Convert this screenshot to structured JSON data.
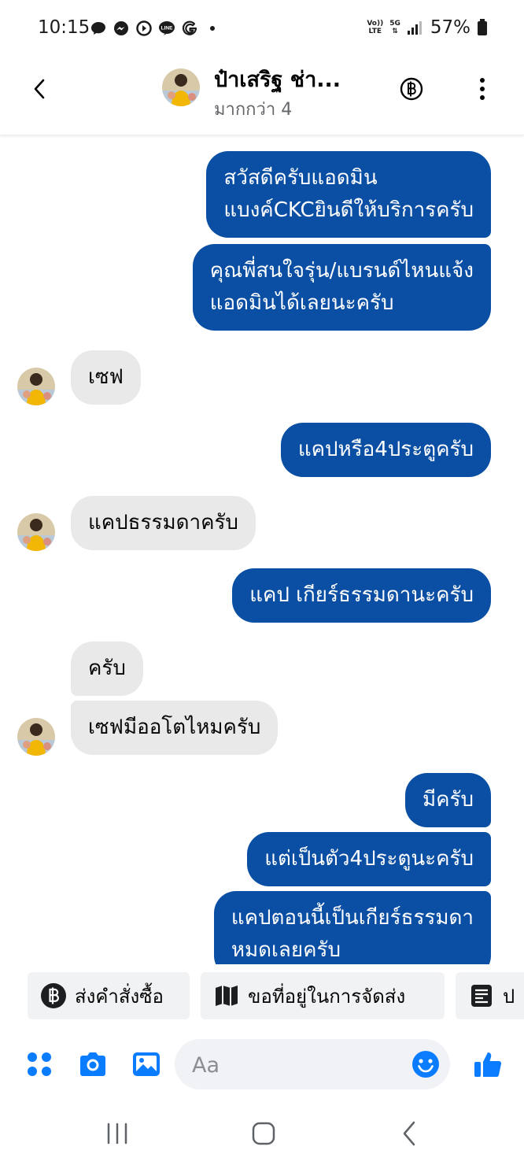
{
  "status_bar": {
    "time": "10:15",
    "network_top": "Vo))",
    "network_bottom": "LTE",
    "signal_type": "5G",
    "battery": "57%",
    "left_icons": [
      "chat-icon",
      "messenger-icon",
      "play-icon",
      "line-icon",
      "google-icon",
      "dot-icon"
    ]
  },
  "header": {
    "contact_name": "ป๋าเสริฐ ช่า...",
    "subtitle": "มากกว่า 4"
  },
  "messages": [
    {
      "dir": "out",
      "lines": [
        "สวัสดีครับแอดมิน",
        "แบงค์CKCยินดีให้บริการครับ"
      ]
    },
    {
      "dir": "out",
      "lines": [
        "คุณพี่สนใจรุ่น/แบรนด์ไหนแจ้ง",
        "แอดมินได้เลยนะครับ"
      ]
    },
    {
      "dir": "in",
      "lines": [
        "เซฟ"
      ]
    },
    {
      "dir": "out",
      "lines": [
        "แคปหรือ4ประตูครับ"
      ]
    },
    {
      "dir": "in",
      "lines": [
        "แคปธรรมดาครับ"
      ]
    },
    {
      "dir": "out",
      "lines": [
        "แคป เกียร์ธรรมดานะครับ"
      ]
    },
    {
      "dir": "in",
      "lines": [
        "ครับ"
      ]
    },
    {
      "dir": "in",
      "lines": [
        "เซฟมีออโตไหมครับ"
      ]
    },
    {
      "dir": "out",
      "lines": [
        "มีครับ"
      ]
    },
    {
      "dir": "out",
      "lines": [
        "แต่เป็นตัว4ประตูนะครับ"
      ]
    },
    {
      "dir": "out",
      "lines": [
        "แคปตอนนี้เป็นเกียร์ธรรมดา",
        "หมดเลยครับ"
      ]
    }
  ],
  "quick_replies": [
    {
      "label": "ส่งคำสั่งซื้อ",
      "icon": "baht-icon"
    },
    {
      "label": "ขอที่อยู่ในการจัดส่ง",
      "icon": "map-icon"
    },
    {
      "label": "ป",
      "icon": "receipt-icon"
    }
  ],
  "composer": {
    "placeholder": "Aa",
    "icons": [
      "apps-icon",
      "camera-icon",
      "gallery-icon",
      "emoji-icon",
      "like-icon"
    ]
  },
  "colors": {
    "outgoing_bubble": "#0a4fa3",
    "incoming_bubble": "#e9e9ea",
    "accent": "#0a7cff"
  }
}
